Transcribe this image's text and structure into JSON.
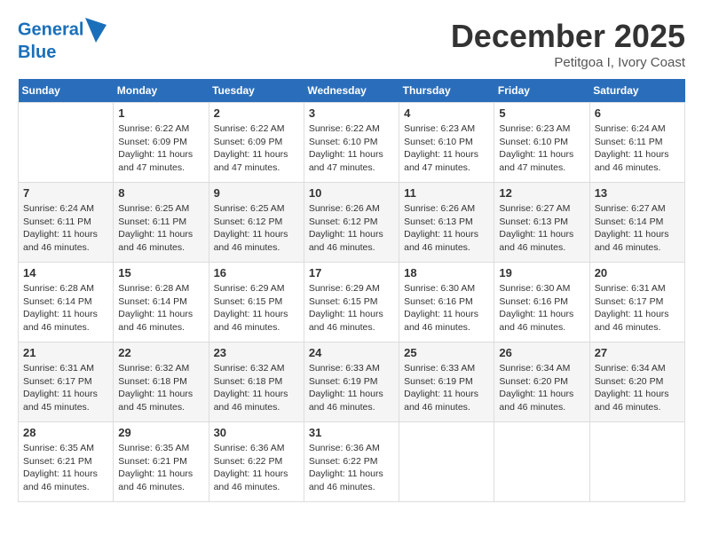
{
  "header": {
    "logo": {
      "line1": "General",
      "line2": "Blue"
    },
    "title": "December 2025",
    "location": "Petitgoa I, Ivory Coast"
  },
  "weekdays": [
    "Sunday",
    "Monday",
    "Tuesday",
    "Wednesday",
    "Thursday",
    "Friday",
    "Saturday"
  ],
  "weeks": [
    [
      {
        "day": "",
        "info": ""
      },
      {
        "day": "1",
        "info": "Sunrise: 6:22 AM\nSunset: 6:09 PM\nDaylight: 11 hours and 47 minutes."
      },
      {
        "day": "2",
        "info": "Sunrise: 6:22 AM\nSunset: 6:09 PM\nDaylight: 11 hours and 47 minutes."
      },
      {
        "day": "3",
        "info": "Sunrise: 6:22 AM\nSunset: 6:10 PM\nDaylight: 11 hours and 47 minutes."
      },
      {
        "day": "4",
        "info": "Sunrise: 6:23 AM\nSunset: 6:10 PM\nDaylight: 11 hours and 47 minutes."
      },
      {
        "day": "5",
        "info": "Sunrise: 6:23 AM\nSunset: 6:10 PM\nDaylight: 11 hours and 47 minutes."
      },
      {
        "day": "6",
        "info": "Sunrise: 6:24 AM\nSunset: 6:11 PM\nDaylight: 11 hours and 46 minutes."
      }
    ],
    [
      {
        "day": "7",
        "info": "Sunrise: 6:24 AM\nSunset: 6:11 PM\nDaylight: 11 hours and 46 minutes."
      },
      {
        "day": "8",
        "info": "Sunrise: 6:25 AM\nSunset: 6:11 PM\nDaylight: 11 hours and 46 minutes."
      },
      {
        "day": "9",
        "info": "Sunrise: 6:25 AM\nSunset: 6:12 PM\nDaylight: 11 hours and 46 minutes."
      },
      {
        "day": "10",
        "info": "Sunrise: 6:26 AM\nSunset: 6:12 PM\nDaylight: 11 hours and 46 minutes."
      },
      {
        "day": "11",
        "info": "Sunrise: 6:26 AM\nSunset: 6:13 PM\nDaylight: 11 hours and 46 minutes."
      },
      {
        "day": "12",
        "info": "Sunrise: 6:27 AM\nSunset: 6:13 PM\nDaylight: 11 hours and 46 minutes."
      },
      {
        "day": "13",
        "info": "Sunrise: 6:27 AM\nSunset: 6:14 PM\nDaylight: 11 hours and 46 minutes."
      }
    ],
    [
      {
        "day": "14",
        "info": "Sunrise: 6:28 AM\nSunset: 6:14 PM\nDaylight: 11 hours and 46 minutes."
      },
      {
        "day": "15",
        "info": "Sunrise: 6:28 AM\nSunset: 6:14 PM\nDaylight: 11 hours and 46 minutes."
      },
      {
        "day": "16",
        "info": "Sunrise: 6:29 AM\nSunset: 6:15 PM\nDaylight: 11 hours and 46 minutes."
      },
      {
        "day": "17",
        "info": "Sunrise: 6:29 AM\nSunset: 6:15 PM\nDaylight: 11 hours and 46 minutes."
      },
      {
        "day": "18",
        "info": "Sunrise: 6:30 AM\nSunset: 6:16 PM\nDaylight: 11 hours and 46 minutes."
      },
      {
        "day": "19",
        "info": "Sunrise: 6:30 AM\nSunset: 6:16 PM\nDaylight: 11 hours and 46 minutes."
      },
      {
        "day": "20",
        "info": "Sunrise: 6:31 AM\nSunset: 6:17 PM\nDaylight: 11 hours and 46 minutes."
      }
    ],
    [
      {
        "day": "21",
        "info": "Sunrise: 6:31 AM\nSunset: 6:17 PM\nDaylight: 11 hours and 45 minutes."
      },
      {
        "day": "22",
        "info": "Sunrise: 6:32 AM\nSunset: 6:18 PM\nDaylight: 11 hours and 45 minutes."
      },
      {
        "day": "23",
        "info": "Sunrise: 6:32 AM\nSunset: 6:18 PM\nDaylight: 11 hours and 46 minutes."
      },
      {
        "day": "24",
        "info": "Sunrise: 6:33 AM\nSunset: 6:19 PM\nDaylight: 11 hours and 46 minutes."
      },
      {
        "day": "25",
        "info": "Sunrise: 6:33 AM\nSunset: 6:19 PM\nDaylight: 11 hours and 46 minutes."
      },
      {
        "day": "26",
        "info": "Sunrise: 6:34 AM\nSunset: 6:20 PM\nDaylight: 11 hours and 46 minutes."
      },
      {
        "day": "27",
        "info": "Sunrise: 6:34 AM\nSunset: 6:20 PM\nDaylight: 11 hours and 46 minutes."
      }
    ],
    [
      {
        "day": "28",
        "info": "Sunrise: 6:35 AM\nSunset: 6:21 PM\nDaylight: 11 hours and 46 minutes."
      },
      {
        "day": "29",
        "info": "Sunrise: 6:35 AM\nSunset: 6:21 PM\nDaylight: 11 hours and 46 minutes."
      },
      {
        "day": "30",
        "info": "Sunrise: 6:36 AM\nSunset: 6:22 PM\nDaylight: 11 hours and 46 minutes."
      },
      {
        "day": "31",
        "info": "Sunrise: 6:36 AM\nSunset: 6:22 PM\nDaylight: 11 hours and 46 minutes."
      },
      {
        "day": "",
        "info": ""
      },
      {
        "day": "",
        "info": ""
      },
      {
        "day": "",
        "info": ""
      }
    ]
  ]
}
